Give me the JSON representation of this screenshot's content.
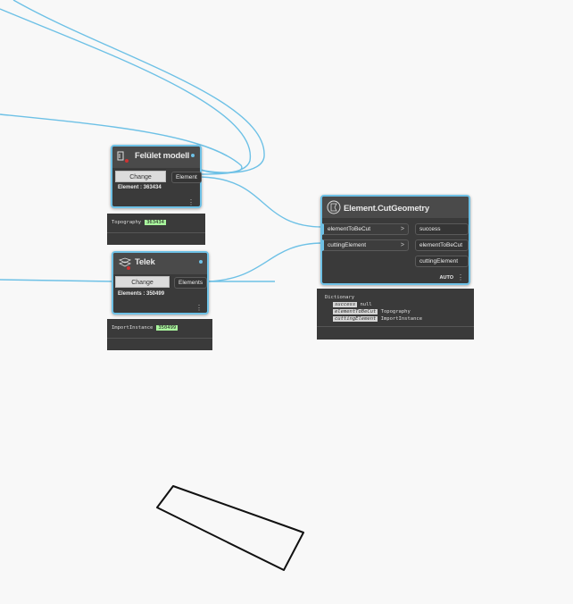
{
  "colors": {
    "wire": "#6ec1e6",
    "node_bg": "#3a3a3a",
    "highlight": "#a9f59d"
  },
  "nodes": {
    "felulet": {
      "title": "Felület modell",
      "change_label": "Change",
      "output_port": "Element",
      "status": "Element : 363434",
      "preview_type": "Topography",
      "preview_value": "363434"
    },
    "telek": {
      "title": "Telek",
      "change_label": "Change",
      "output_port": "Elements",
      "status": "Elements : 350499",
      "preview_type": "ImportInstance",
      "preview_value": "350499"
    },
    "cut_geometry": {
      "title": "Element.CutGeometry",
      "inputs": [
        {
          "label": "elementToBeCut",
          "arrow": ">"
        },
        {
          "label": "cuttingElement",
          "arrow": ">"
        }
      ],
      "outputs": [
        "success",
        "elementToBeCut",
        "cuttingElement"
      ],
      "lacing": "AUTO",
      "preview": {
        "header": "Dictionary",
        "rows": [
          {
            "key": "success",
            "value": "null"
          },
          {
            "key": "elementToBeCut",
            "value": "Topography"
          },
          {
            "key": "cuttingElement",
            "value": "ImportInstance"
          }
        ]
      }
    }
  }
}
